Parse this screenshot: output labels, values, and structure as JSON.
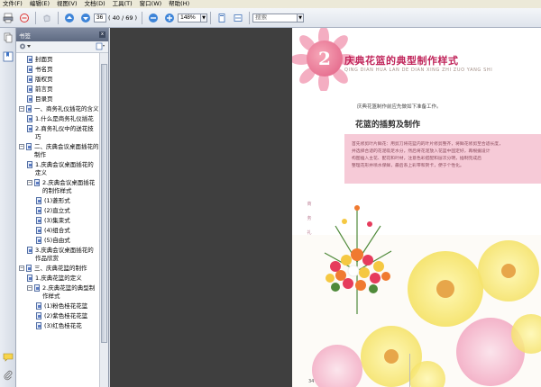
{
  "menubar": {
    "items": [
      "文件(F)",
      "编辑(E)",
      "视图(V)",
      "文档(D)",
      "工具(T)",
      "窗口(W)",
      "帮助(H)"
    ]
  },
  "toolbar": {
    "page_current": "36",
    "page_total": "( 40 / 69 )",
    "zoom": "148%",
    "search_placeholder": "搜索"
  },
  "bookmarks": {
    "header_label": "书签",
    "close_label": "x",
    "items": [
      {
        "label": "封面页",
        "level": 1,
        "type": "page"
      },
      {
        "label": "书名页",
        "level": 1,
        "type": "page"
      },
      {
        "label": "版权页",
        "level": 1,
        "type": "page"
      },
      {
        "label": "前言页",
        "level": 1,
        "type": "page"
      },
      {
        "label": "目录页",
        "level": 1,
        "type": "page"
      },
      {
        "label": "一、商务礼仪插花的含义",
        "level": 0,
        "type": "toggle"
      },
      {
        "label": "1.什么是商务礼仪插花",
        "level": 1,
        "type": "page"
      },
      {
        "label": "2.商务礼仪中的送花技巧",
        "level": 1,
        "type": "page"
      },
      {
        "label": "二、庆典会议桌面插花的制作",
        "level": 0,
        "type": "toggle"
      },
      {
        "label": "1.庆典会议桌面插花的定义",
        "level": 1,
        "type": "page"
      },
      {
        "label": "2.庆典会议桌面插花的制作样式",
        "level": 1,
        "type": "toggle"
      },
      {
        "label": "(1)菱形式",
        "level": 2,
        "type": "page"
      },
      {
        "label": "(2)直立式",
        "level": 2,
        "type": "page"
      },
      {
        "label": "(3)集束式",
        "level": 2,
        "type": "page"
      },
      {
        "label": "(4)组合式",
        "level": 2,
        "type": "page"
      },
      {
        "label": "(5)自由式",
        "level": 2,
        "type": "page"
      },
      {
        "label": "3.庆典会议桌面插花的作品欣赏",
        "level": 1,
        "type": "page"
      },
      {
        "label": "三、庆典花篮的制作",
        "level": 0,
        "type": "toggle"
      },
      {
        "label": "1.庆典花篮的定义",
        "level": 1,
        "type": "page"
      },
      {
        "label": "2.庆典花篮的典型制作样式",
        "level": 1,
        "type": "toggle"
      },
      {
        "label": "(1)粉色桂花花篮",
        "level": 2,
        "type": "page"
      },
      {
        "label": "(2)紫色桂花花篮",
        "level": 2,
        "type": "page"
      },
      {
        "label": "(3)红色桂花花",
        "level": 2,
        "type": "page"
      }
    ]
  },
  "page": {
    "chapter_number": "2",
    "chapter_title": "庆典花篮的典型制作样式",
    "chapter_subtitle": "QING DIAN HUA LAN DE DIAN XING ZHI ZUO YANG SHI",
    "intro": "庆典花篮制作前应先做如下准备工作。",
    "section_heading": "花篮的插剪及制作",
    "paragraph_lines": [
      "首先修剪叶片鲜花：用剪刀将花篮内的叶片修剪整齐，将鲜花修剪至合适长度，",
      "并选择合适的花泥吸足水分，然后将花泥放入花篮中固定好，再根据设计",
      "构图插入主花、配花和叶材，注意色彩搭配和层次分明，插制完成后",
      "整理花形并喷水保鲜，最后系上彩带和贺卡，便于个性化。"
    ],
    "side_vertical": [
      "商",
      "务",
      "礼",
      "仪",
      "插",
      "花"
    ],
    "page_number": "34"
  },
  "colors": {
    "chapter_accent": "#c0245a",
    "paragraph_bg": "#f6cad7"
  }
}
